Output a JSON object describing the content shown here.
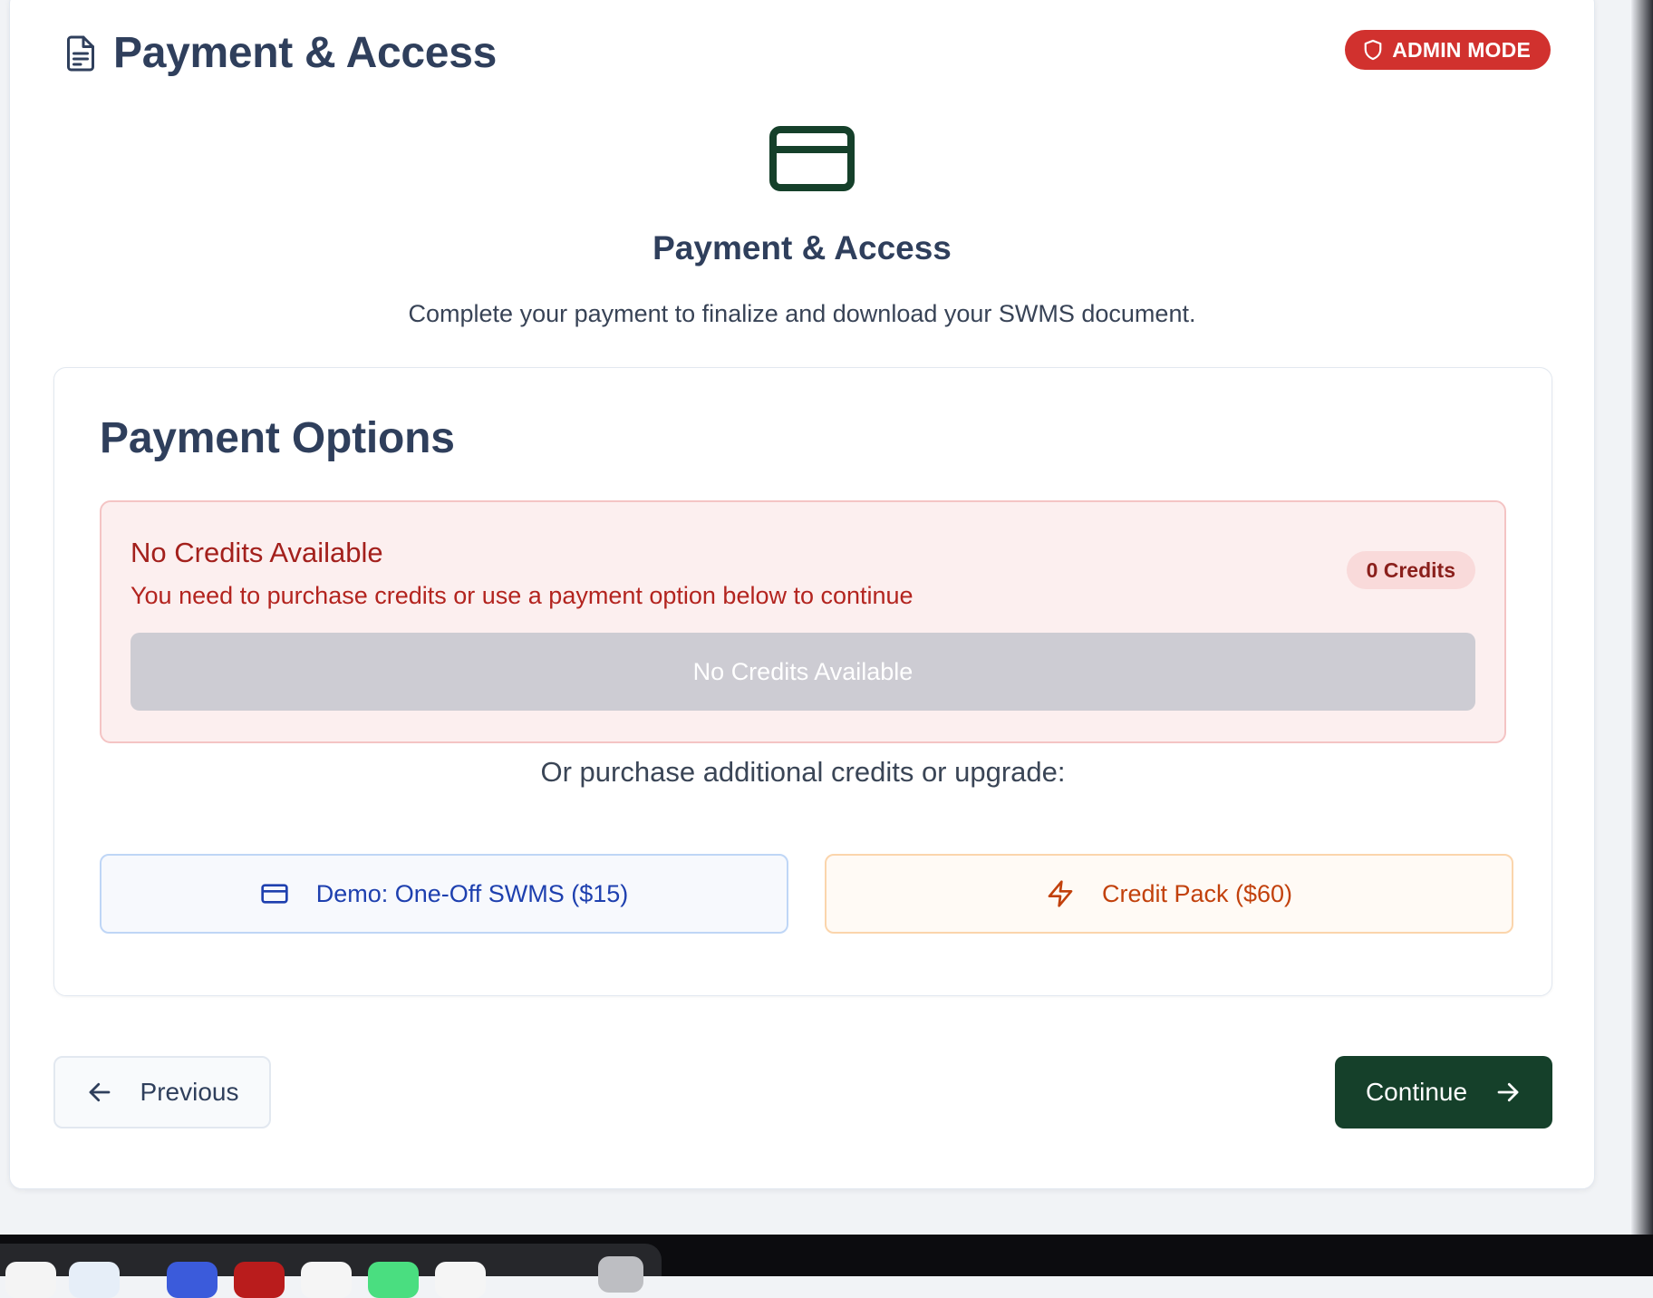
{
  "header": {
    "title": "Payment & Access",
    "admin_badge": "ADMIN MODE"
  },
  "hero": {
    "title": "Payment & Access",
    "description": "Complete your payment to finalize and download your SWMS document."
  },
  "payment_options": {
    "title": "Payment Options",
    "alert": {
      "title": "No Credits Available",
      "description": "You need to purchase credits or use a payment option below to continue",
      "credits_badge": "0 Credits",
      "button_label": "No Credits Available"
    },
    "upgrade_prompt": "Or purchase additional credits or upgrade:",
    "options": [
      {
        "label": "Demo: One-Off SWMS ($15)",
        "icon": "credit-card-icon"
      },
      {
        "label": "Credit Pack ($60)",
        "icon": "lightning-icon"
      }
    ]
  },
  "navigation": {
    "previous": "Previous",
    "continue": "Continue"
  },
  "colors": {
    "admin_badge": "#d1312e",
    "primary": "#15402a",
    "alert_bg": "#fcefef",
    "alert_text": "#a3201c",
    "demo_option": "#1e40af",
    "pack_option": "#c2410c"
  }
}
